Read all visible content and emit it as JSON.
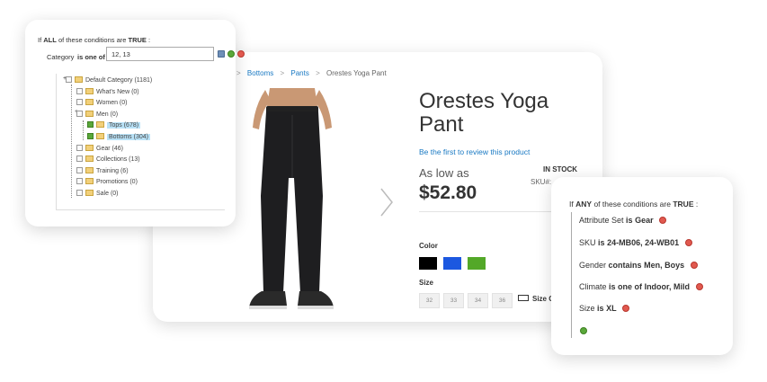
{
  "product": {
    "breadcrumb": [
      ">",
      "Bottoms",
      ">",
      "Pants",
      ">",
      "Orestes Yoga Pant"
    ],
    "title_line1": "Orestes Yoga",
    "title_line2": "Pant",
    "review_link": "Be the first to review this product",
    "price_label": "As low as",
    "price": "$52.80",
    "stock": "IN STOCK",
    "sku_label": "SKU#:",
    "color_label": "Color",
    "swatches": [
      "#000000",
      "#1c58e0",
      "#53a828"
    ],
    "size_label": "Size",
    "sizes": [
      "32",
      "33",
      "34",
      "36"
    ],
    "size_chart": "Size C",
    "next_icon": "chevron-right-icon"
  },
  "category_panel": {
    "header_if": "If",
    "header_all": "ALL",
    "header_mid": "of these conditions are",
    "header_true": "TRUE",
    "header_end": ":",
    "condition_label": "Category",
    "condition_operator": "is one of",
    "condition_value": "12, 13",
    "tree": [
      {
        "label": "Default Category (1181)",
        "checked": false,
        "selected": false
      },
      {
        "label": "What's New (0)",
        "checked": false,
        "selected": false
      },
      {
        "label": "Women (0)",
        "checked": false,
        "selected": false
      },
      {
        "label": "Men (0)",
        "checked": false,
        "selected": false
      },
      {
        "label": "Tops (678)",
        "checked": true,
        "selected": true
      },
      {
        "label": "Bottoms (304)",
        "checked": true,
        "selected": true
      },
      {
        "label": "Gear (46)",
        "checked": false,
        "selected": false
      },
      {
        "label": "Collections (13)",
        "checked": false,
        "selected": false
      },
      {
        "label": "Training (6)",
        "checked": false,
        "selected": false
      },
      {
        "label": "Promotions (0)",
        "checked": false,
        "selected": false
      },
      {
        "label": "Sale (0)",
        "checked": false,
        "selected": false
      }
    ],
    "icons": {
      "chooser": "list-icon",
      "apply": "check-circle-icon",
      "remove": "remove-icon"
    },
    "icon_colors": {
      "apply": "#5aa83a",
      "remove": "#e1594f",
      "chooser": "#6f8fb8"
    }
  },
  "attr_panel": {
    "header_if": "If",
    "header_any": "ANY",
    "header_mid": "of these conditions are",
    "header_true": "TRUE",
    "header_end": ":",
    "conditions": [
      {
        "attribute": "Attribute Set",
        "operator": "is",
        "value": "Gear"
      },
      {
        "attribute": "SKU",
        "operator": "is",
        "value": "24-MB06, 24-WB01"
      },
      {
        "attribute": "Gender",
        "operator": "contains",
        "value": "Men, Boys"
      },
      {
        "attribute": "Climate",
        "operator": "is one of",
        "value": "Indoor, Mild"
      },
      {
        "attribute": "Size",
        "operator": "is",
        "value": "XL"
      }
    ],
    "add_icon": "add-condition-icon"
  }
}
